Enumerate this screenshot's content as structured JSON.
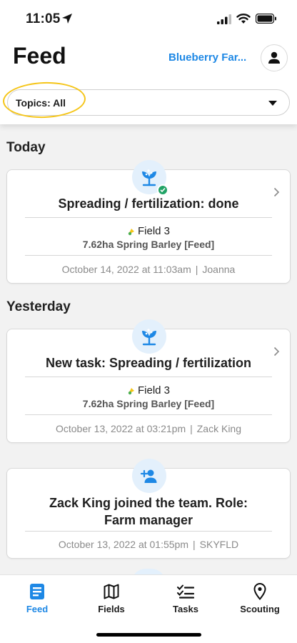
{
  "status_bar": {
    "time": "11:05"
  },
  "header": {
    "title": "Feed",
    "farm_name": "Blueberry Far...",
    "topics_filter": "Topics: All"
  },
  "colors": {
    "accent": "#1e88e5",
    "success": "#21a366",
    "icon_bg": "#e3f0fc",
    "highlight": "#f5c518"
  },
  "feed": {
    "sections": [
      {
        "title": "Today",
        "cards": [
          {
            "icon": "sprout-icon",
            "title": "Spreading / fertilization: done",
            "field": "Field 3",
            "crop": "7.62ha  Spring Barley [Feed]",
            "date": "October 14, 2022 at 11:03am",
            "author": "Joanna"
          }
        ]
      },
      {
        "title": "Yesterday",
        "cards": [
          {
            "icon": "sprout-icon",
            "title": "New task: Spreading / fertilization",
            "field": "Field 3",
            "crop": "7.62ha  Spring Barley [Feed]",
            "date": "October 13, 2022 at 03:21pm",
            "author": "Zack King"
          },
          {
            "icon": "add-person-icon",
            "title_line1": "Zack King joined the team. Role:",
            "title_line2": "Farm manager",
            "date": "October 13, 2022 at 01:55pm",
            "author": "SKYFLD"
          }
        ]
      }
    ],
    "separator": "|"
  },
  "tabbar": {
    "tabs": [
      {
        "label": "Feed",
        "icon": "feed-icon",
        "active": true
      },
      {
        "label": "Fields",
        "icon": "map-icon",
        "active": false
      },
      {
        "label": "Tasks",
        "icon": "checklist-icon",
        "active": false
      },
      {
        "label": "Scouting",
        "icon": "location-pin-icon",
        "active": false
      }
    ]
  }
}
